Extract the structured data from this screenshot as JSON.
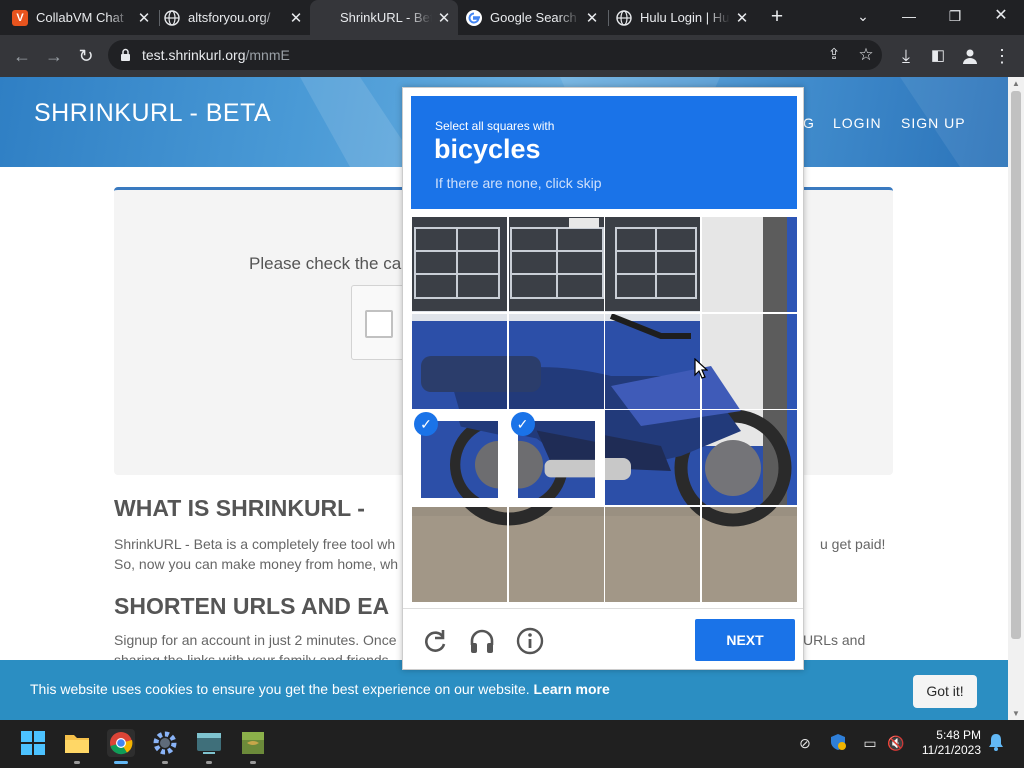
{
  "browser": {
    "tabs": [
      {
        "title": "CollabVM Chat",
        "favicon": "collabvm-icon",
        "active": false
      },
      {
        "title": "altsforyou.org/",
        "favicon": "globe-icon",
        "active": false
      },
      {
        "title": "ShrinkURL - Beta",
        "favicon": "none",
        "active": true
      },
      {
        "title": "Google Search",
        "favicon": "google-icon",
        "active": false
      },
      {
        "title": "Hulu Login | Hulu",
        "favicon": "globe-icon",
        "active": false
      }
    ],
    "url_host": "test.shrinkurl.org",
    "url_path": "/mnmE"
  },
  "site": {
    "logo": "SHRINKURL - BETA",
    "nav": [
      {
        "label": "G"
      },
      {
        "label": "LOGIN"
      },
      {
        "label": "SIGN UP"
      }
    ],
    "check_prompt": "Please check the ca",
    "heading1": "WHAT IS SHRINKURL -",
    "para1_line1": "ShrinkURL - Beta is a completely free tool wh",
    "para1_line1_right": "u get paid!",
    "para1_line2": "So, now you can make money from home, wh",
    "heading2": "SHORTEN URLS AND EA",
    "para2_line1": "Signup for an account in just 2 minutes. Once",
    "para2_line1_right": "URLs and",
    "para2_line2": "sharing the links with your family and friends."
  },
  "cookie": {
    "text": "This website uses cookies to ensure you get the best experience on our website.",
    "learn_more": "Learn more",
    "button": "Got it!"
  },
  "captcha": {
    "instruction": "Select all squares with",
    "target": "bicycles",
    "skip_hint": "If there are none, click skip",
    "selected_tiles": [
      8,
      9
    ],
    "next_label": "NEXT",
    "accent": "#1a73e8"
  },
  "taskbar": {
    "apps": [
      "windows-start-icon",
      "file-explorer-icon",
      "chrome-icon",
      "settings-icon",
      "terminal-icon",
      "minecraft-icon"
    ],
    "time": "5:48 PM",
    "date": "11/21/2023"
  }
}
